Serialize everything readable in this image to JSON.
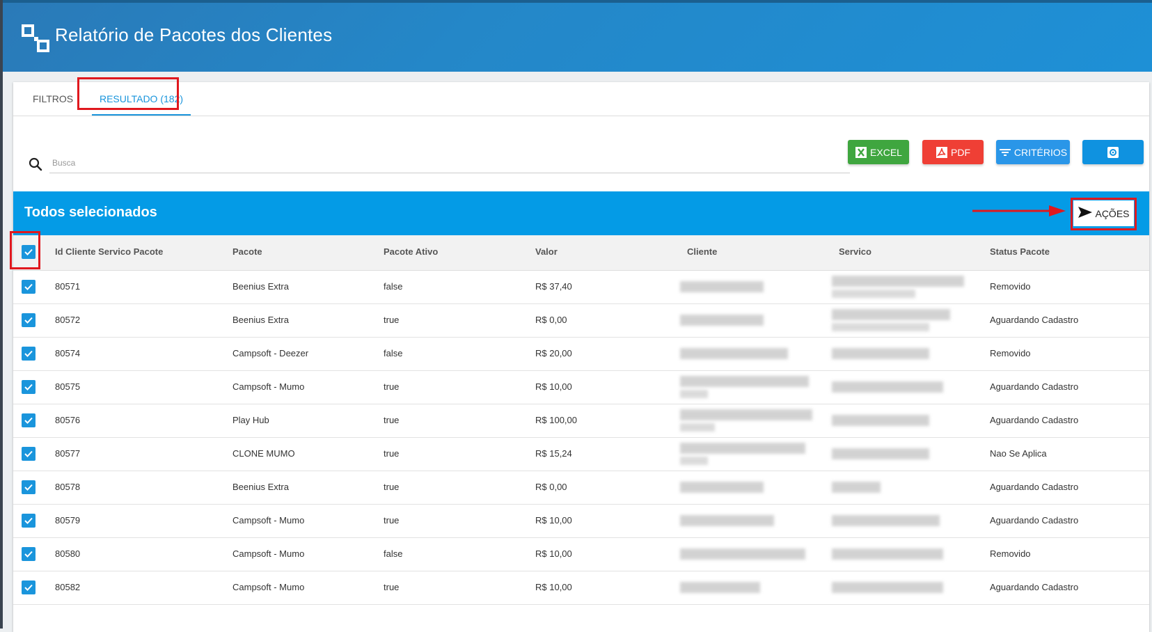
{
  "header": {
    "title": "Relatório de Pacotes dos Clientes",
    "logo_icon": "report-squares-icon"
  },
  "tabs": [
    {
      "label": "FILTROS",
      "active": false
    },
    {
      "label": "RESULTADO (182)",
      "active": true
    }
  ],
  "search": {
    "placeholder": "Busca",
    "value": "",
    "icon": "search-icon"
  },
  "toolbar": {
    "excel_label": "EXCEL",
    "pdf_label": "PDF",
    "criterios_label": "CRITÉRIOS",
    "settings_icon": "gear-icon"
  },
  "selection_bar": {
    "text": "Todos selecionados",
    "acoes_label": "AÇÕES"
  },
  "colors": {
    "header": "#2487c8",
    "accent": "#1a95dc",
    "selection_bar": "#049be6",
    "excel": "#3fa63f",
    "pdf": "#ef3f35",
    "criterios": "#2a96e8",
    "highlight": "#e0181e"
  },
  "table": {
    "columns": [
      "Id Cliente Servico Pacote",
      "Pacote",
      "Pacote Ativo",
      "Valor",
      "Cliente",
      "Servico",
      "Status Pacote"
    ],
    "select_all_checked": true,
    "rows": [
      {
        "id": "80571",
        "pacote": "Beenius Extra",
        "ativo": "false",
        "valor": "R$ 37,40",
        "status": "Removido",
        "checked": true
      },
      {
        "id": "80572",
        "pacote": "Beenius Extra",
        "ativo": "true",
        "valor": "R$ 0,00",
        "status": "Aguardando Cadastro",
        "checked": true
      },
      {
        "id": "80574",
        "pacote": "Campsoft - Deezer",
        "ativo": "false",
        "valor": "R$ 20,00",
        "status": "Removido",
        "checked": true
      },
      {
        "id": "80575",
        "pacote": "Campsoft - Mumo",
        "ativo": "true",
        "valor": "R$ 10,00",
        "status": "Aguardando Cadastro",
        "checked": true
      },
      {
        "id": "80576",
        "pacote": "Play Hub",
        "ativo": "true",
        "valor": "R$ 100,00",
        "status": "Aguardando Cadastro",
        "checked": true
      },
      {
        "id": "80577",
        "pacote": "CLONE MUMO",
        "ativo": "true",
        "valor": "R$ 15,24",
        "status": "Nao Se Aplica",
        "checked": true
      },
      {
        "id": "80578",
        "pacote": "Beenius Extra",
        "ativo": "true",
        "valor": "R$ 0,00",
        "status": "Aguardando Cadastro",
        "checked": true
      },
      {
        "id": "80579",
        "pacote": "Campsoft - Mumo",
        "ativo": "true",
        "valor": "R$ 10,00",
        "status": "Aguardando Cadastro",
        "checked": true
      },
      {
        "id": "80580",
        "pacote": "Campsoft - Mumo",
        "ativo": "false",
        "valor": "R$ 10,00",
        "status": "Removido",
        "checked": true
      },
      {
        "id": "80582",
        "pacote": "Campsoft - Mumo",
        "ativo": "true",
        "valor": "R$ 10,00",
        "status": "Aguardando Cadastro",
        "checked": true
      }
    ]
  }
}
